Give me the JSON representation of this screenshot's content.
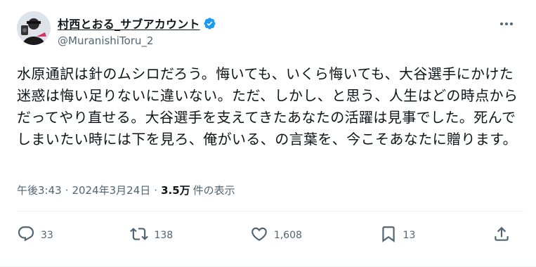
{
  "author": {
    "display_name": "村西とおる_サブアカウント",
    "handle": "@MuranishiToru_2",
    "verified": true,
    "avatar_icon": "profile-photo"
  },
  "post": {
    "text": "水原通訳は針のムシロだろう。悔いても、いくら悔いても、大谷選手にかけた迷惑は悔い足りないに違いない。ただ、しかし、と思う、人生はどの時点からだってやり直せる。大谷選手を支えてきたあなたの活躍は見事でした。死んでしまいたい時には下を見ろ、俺がいる、の言葉を、今こそあなたに贈ります。",
    "time": "午後3:43",
    "date": "2024年3月24日",
    "views_count": "3.5万",
    "views_label": "件の表示"
  },
  "actions": {
    "reply_count": "33",
    "repost_count": "138",
    "like_count": "1,608",
    "bookmark_count": "13"
  },
  "colors": {
    "text": "#0f1419",
    "secondary": "#536471",
    "verified": "#1d9bf0"
  }
}
